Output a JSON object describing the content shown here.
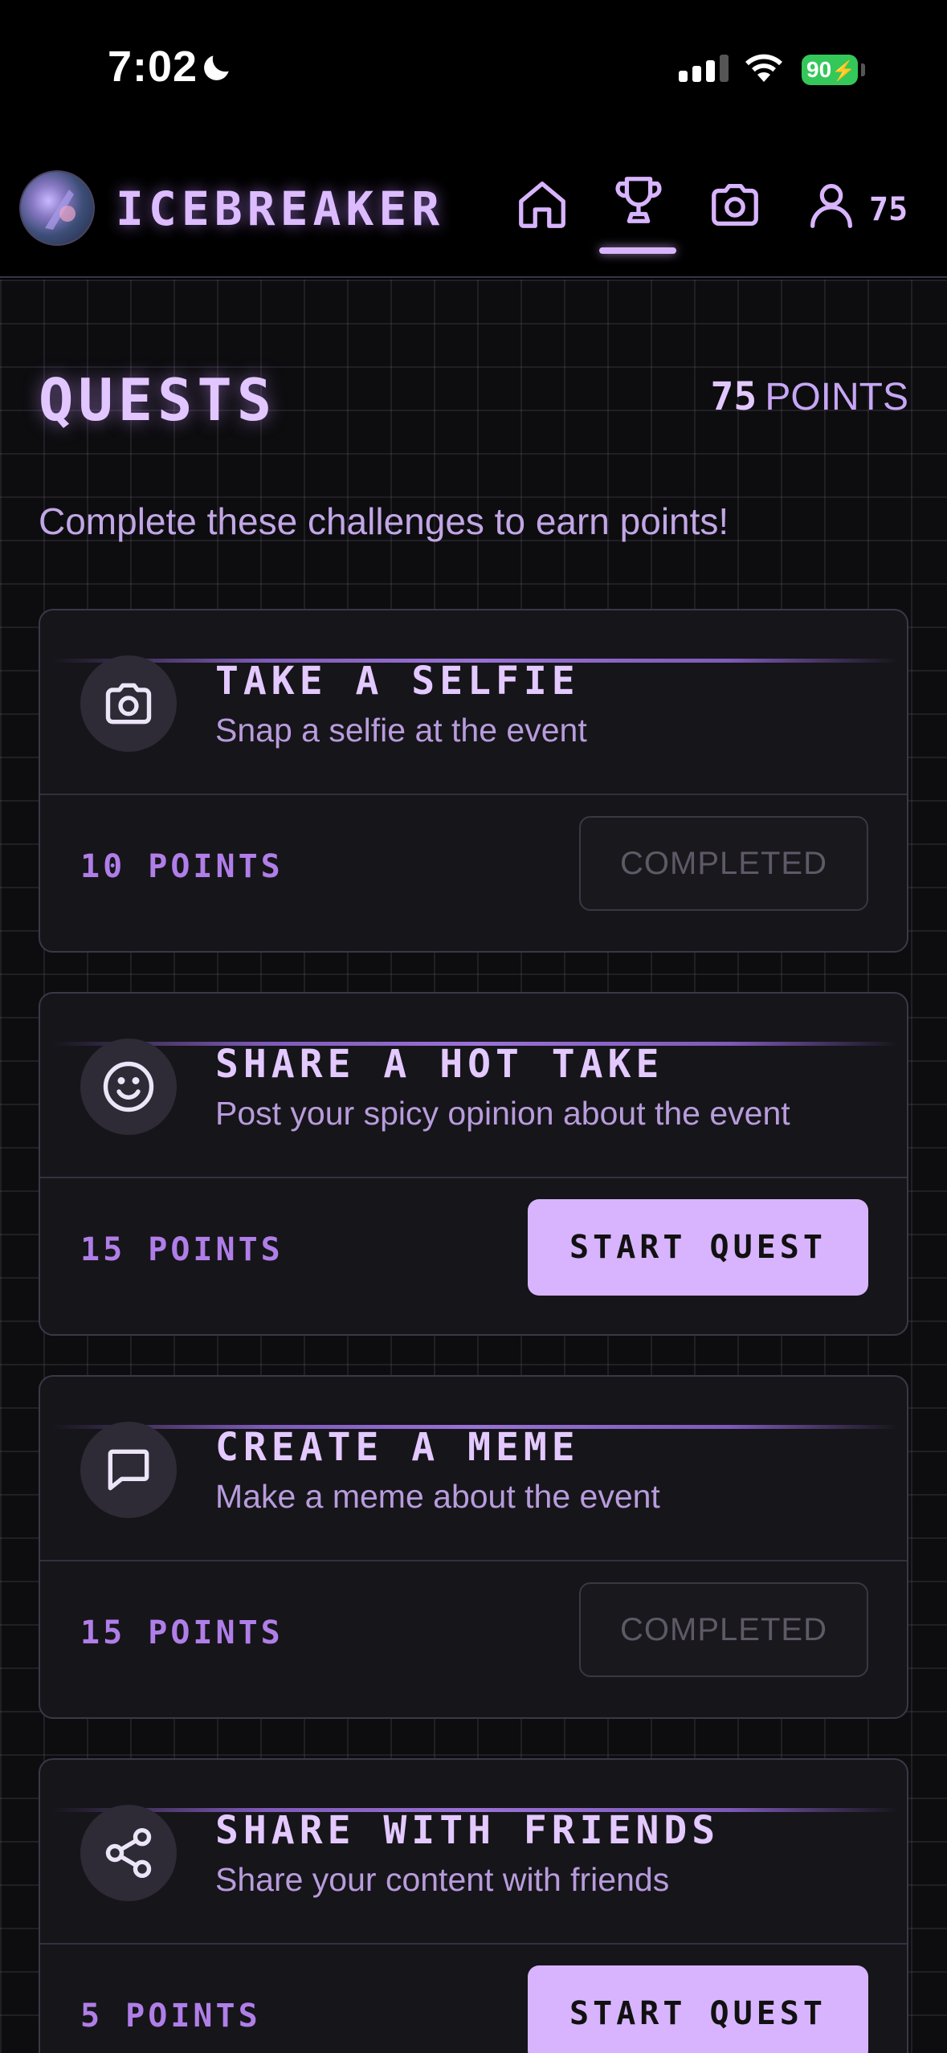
{
  "status_bar": {
    "time": "7:02",
    "battery": "90"
  },
  "header": {
    "app_name": "ICEBREAKER",
    "points": "75",
    "nav": [
      "home-icon",
      "trophy-icon",
      "camera-icon",
      "user-icon"
    ],
    "active_nav": "trophy-icon"
  },
  "page": {
    "title": "QUESTS",
    "total_points": "75",
    "total_points_label": "POINTS",
    "subtitle": "Complete these challenges to earn points!"
  },
  "quests": [
    {
      "icon": "camera-icon",
      "title": "TAKE A SELFIE",
      "description": "Snap a selfie at the event",
      "points": "10 POINTS",
      "status": "completed",
      "button": "COMPLETED"
    },
    {
      "icon": "smiley-icon",
      "title": "SHARE A HOT TAKE",
      "description": "Post your spicy opinion about the event",
      "points": "15 POINTS",
      "status": "available",
      "button": "START QUEST"
    },
    {
      "icon": "message-icon",
      "title": "CREATE A MEME",
      "description": "Make a meme about the event",
      "points": "15 POINTS",
      "status": "completed",
      "button": "COMPLETED"
    },
    {
      "icon": "share-icon",
      "title": "SHARE WITH FRIENDS",
      "description": "Share your content with friends",
      "points": "5 POINTS",
      "status": "available",
      "button": "START QUEST"
    }
  ],
  "colors": {
    "accent": "#d8b4fe",
    "background": "#0d0d0f",
    "card": "#16151a",
    "battery": "#34c759"
  }
}
